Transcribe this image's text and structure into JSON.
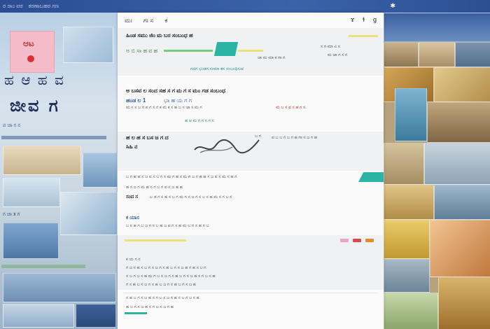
{
  "topbar": {
    "crumb1": "ಠ ಠಾಂ ಪಠ",
    "crumb2": "ಕಠಣಾಬಹಠ ಗಣ",
    "star": "✱"
  },
  "left": {
    "poster_text": "ಆಟ",
    "headline1": "ಹ ಆ ಹ ವ",
    "headline2": "ಜೀವ ಗ",
    "note1": "ಪ ಜಾ ಸ ನ",
    "note2": "ಗ ಚಾ ತ ಗ"
  },
  "doc": {
    "nav": {
      "items": [
        "ಮಃ",
        "ಗಃ ಸ",
        "ಕ"
      ],
      "icons": [
        "search-icon",
        "user-icon",
        "settings-icon"
      ],
      "icon_glyphs": [
        "ɤ",
        "ɬ",
        "ɡ"
      ]
    },
    "section1": {
      "title": "ಹಿಂಡ ಸಮು ಜಿಂ ಮ ಬರ ಸಂಬಂಧ ಹ",
      "line2": "ಅ ಬಿ ಸಾ ಹ ವ ಹ",
      "caption": "ಗದಗ ಭಂಡಗ ಸಂಮಾ ತಸ ಸಂಬಂಧಿಸುವ",
      "right_line1": "ಸ ಗ ಮಾ ವಿ ಸ",
      "right_line2": "ಮ ಜಾ ಗ ಸ ಗ",
      "mid_line": "ಜಾ ಮ ಮಾ ಕ ಗಾ ಗ"
    },
    "section2": {
      "title": "ಅ ಬಸವ ಲ ಸಂದ ಸಹ ಸ ಗ ಮ ಗ ಸ ಮಂ ಗಡ ಸಂಬಂಧ",
      "line2_lead": "ಹಂಡ ಲ 1",
      "line2_mid": "ಭಾ ಹ ಯ ಗ ಗ",
      "line3": "ಮ ಸ ಸ ಬ ಗ ಪ ಗ ಸ ನ ಕ ಮ ಕ ಸ ಹ ಬ ಸ ಜಾ ಸ ಮ ಗ",
      "line3_red": "ಮ ಬ ಸ ಪ ಸ ಹ ಗ ಸ"
    },
    "section3": {
      "title": "ಹ ಲ ಹ ಸ ಬಸ ಜ ಗ ದ",
      "sub": "ಸಿಹಿ ನ",
      "teal_line": "ಹ ಆ ಮ ಗ ಗ ಗ ಗ ಸ",
      "right_line": "ಪ ಬ ಬ ಗ ಬ ಗ ಹ ಗಾ ಸ ಜ ಗ ಹ",
      "right_line2": "ಬ ಗ"
    },
    "section4": {
      "line1": "ಬ ಗ ಹ ಹ ಸ ಜ ಪ ಸ ಬ ಗ ಸ ಮ ಗ ಹ ಸ ಮ ಗ ಜ ಗ ಹ ಹ ಸ ಜ ಪ ಸ ಮ ಸ ಹ ಗ",
      "line2": "ಹ ಸ ಜ ಗ ಮ ಹ ಸ ಗ ಬ ಗ ಪ ಸ ಜ ಹ ಹ",
      "line3_lead": "ಸಂದ ಸ",
      "line3": "ಬ ಡ ಗ ಸ ಹ ಸ ಬ ಗ ಮ ಗ ಸ ಜ ಗ ಸ ಬ ಸ ಹ ಮ ಸ ಗ ಬ ಸ",
      "line4_lead": "ಕ ಯಾಸ",
      "line4": "ಬ ಸ ಹ ಗ ಬ ಜ ಗ ಸ ಬ ಹ ಜ ಪ ಗ ಸ ಹ ಮ ಬ ಗ ಸ ಹ ಗ ಬ"
    },
    "section5": {
      "line1": "ಕ ಯ ಗ ಸ",
      "line2": "ಗ ಜ ಸ ಹ ಸ ಬ ಗ ಸ ಜ ಗ ಸ ಹ ಬ ಗ ಸ ಜ ಹ ಗ ಹ ಸ ಬ ಗ",
      "line3": "ಸ ಬ ಗ ಜ ಸ ಹ ಮ ಗ ಬ ಸ ಜ ಗ ಸ ಹ ಬ ಗ ಸ ಜ ಹ ಸ ಗ ಬ ಸ ಹ",
      "line4": "ಗ ಸ ಹ ಬ ಸ ಜ ಗ ಸ ಹ ಬ ಜ ಗ ಸ ಹ ಬ ಗ ಸ ಜ ಹ"
    },
    "section6": {
      "line1": "ಸ ಹ ಬ ಗ ಸ ಜ ಹ ಸ ಗ ಬ ಸ ಜ ಗ ಹ ಸ ಬ ಗ ಜ ಸ ಹ",
      "line2": "ಹ ಬ ಗ ಸ ಜ ಹ ಸ ಗ ಬ ಸ ಜ ಗ ಹ"
    },
    "colors": {
      "teal": "#2bb3a3",
      "yellow": "#ece27a",
      "green": "#6fcf7a",
      "pink": "#e6a6c8",
      "red": "#d94a4a",
      "orange": "#e28a2e"
    }
  }
}
